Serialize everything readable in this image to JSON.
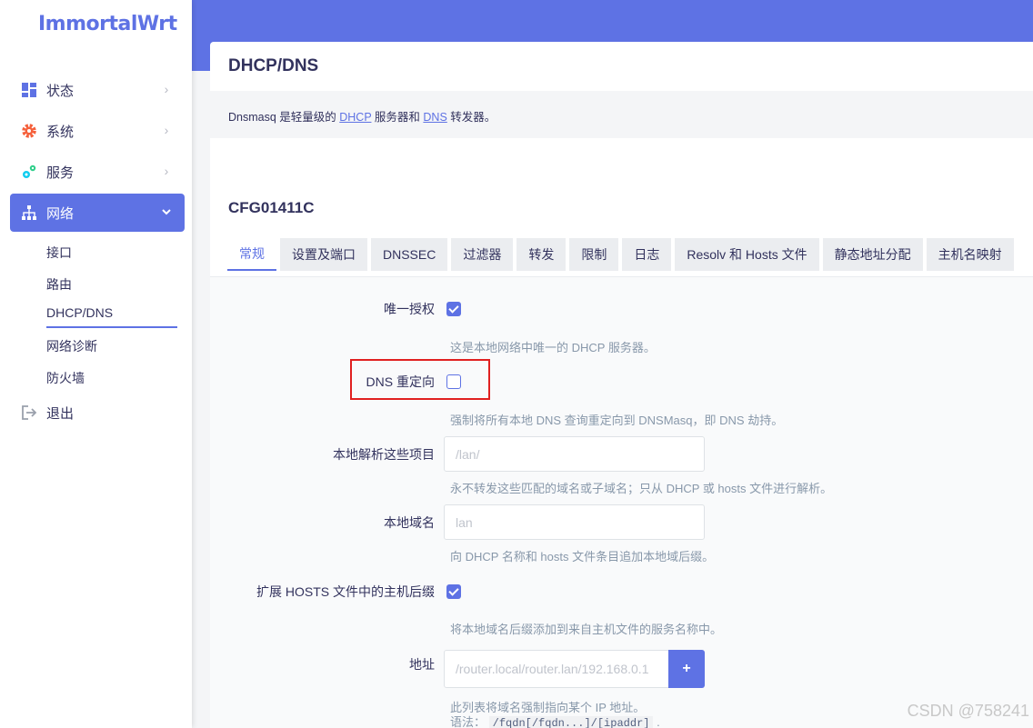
{
  "brand": "ImmortalWrt",
  "nav": {
    "status": "状态",
    "system": "系统",
    "services": "服务",
    "network": "网络",
    "logout": "退出",
    "network_sub": [
      "接口",
      "路由",
      "DHCP/DNS",
      "网络诊断",
      "防火墙"
    ]
  },
  "page": {
    "title": "DHCP/DNS",
    "desc_prefix": "Dnsmasq 是轻量级的 ",
    "desc_dhcp": "DHCP",
    "desc_mid": " 服务器和 ",
    "desc_dns": "DNS",
    "desc_suffix": " 转发器。"
  },
  "section": {
    "title": "CFG01411C",
    "tabs": [
      "常规",
      "设置及端口",
      "DNSSEC",
      "过滤器",
      "转发",
      "限制",
      "日志",
      "Resolv 和 Hosts 文件",
      "静态地址分配",
      "主机名映射"
    ]
  },
  "form": {
    "authoritative": {
      "label": "唯一授权",
      "checked": true,
      "hint": "这是本地网络中唯一的 DHCP 服务器。"
    },
    "dns_redirect": {
      "label": "DNS 重定向",
      "checked": false,
      "hint": "强制将所有本地 DNS 查询重定向到 DNSMasq，即 DNS 劫持。"
    },
    "local": {
      "label": "本地解析这些项目",
      "placeholder": "/lan/",
      "hint": "永不转发这些匹配的域名或子域名；只从 DHCP 或 hosts 文件进行解析。"
    },
    "domain": {
      "label": "本地域名",
      "placeholder": "lan",
      "hint": "向 DHCP 名称和 hosts 文件条目追加本地域后缀。"
    },
    "expandhosts": {
      "label": "扩展 HOSTS 文件中的主机后缀",
      "checked": true,
      "hint": "将本地域名后缀添加到来自主机文件的服务名称中。"
    },
    "address": {
      "label": "地址",
      "placeholder": "/router.local/router.lan/192.168.0.1",
      "add": "+",
      "hint": "此列表将域名强制指向某个 IP 地址。",
      "syntax_label": "语法：",
      "syntax": "/fqdn[/fqdn...]/[ipaddr]",
      "syntax_end": "."
    }
  },
  "watermark": "CSDN @758241",
  "colors": {
    "accent": "#5e72e4",
    "highlight": "#e02020"
  }
}
